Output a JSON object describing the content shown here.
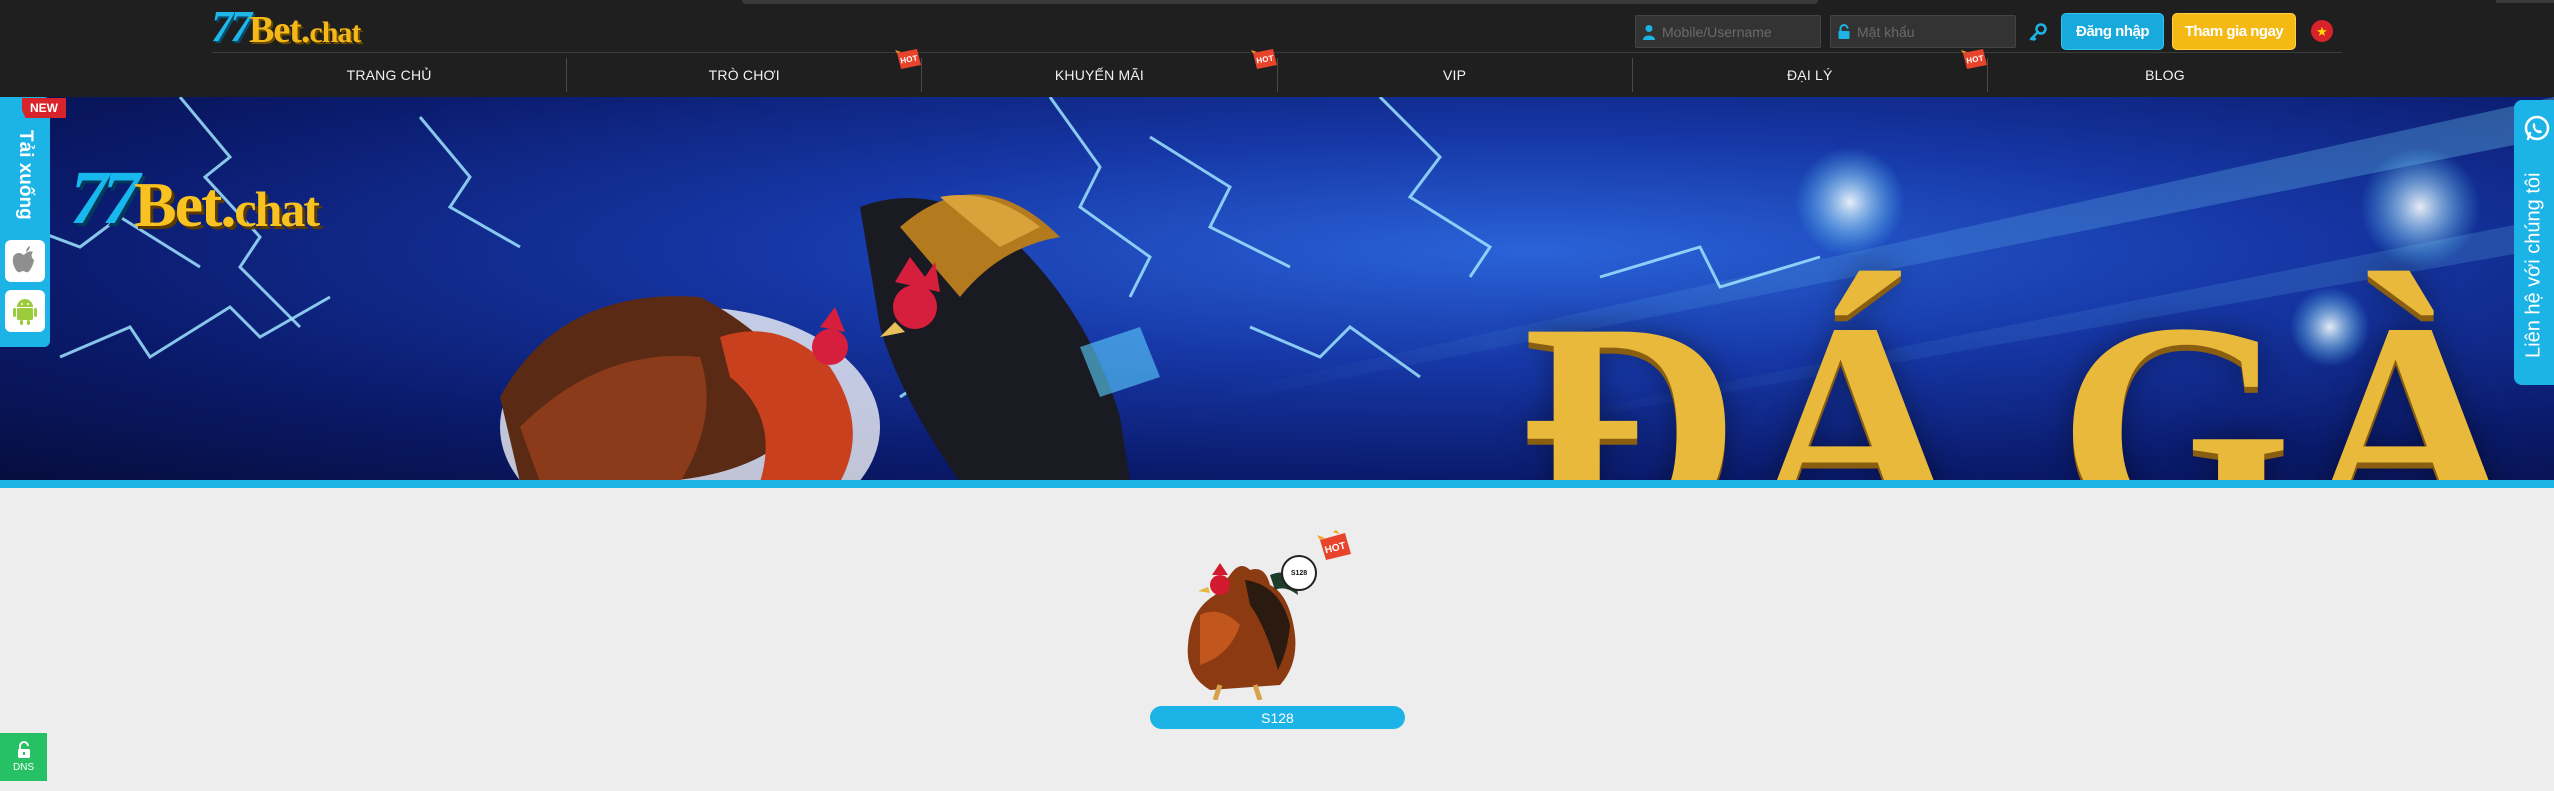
{
  "header": {
    "logo": {
      "number": "77",
      "brand": "Bet.",
      "suffix": "chat"
    },
    "username_placeholder": "Mobile/Username",
    "password_placeholder": "Mật khẩu",
    "login_label": "Đăng nhập",
    "join_label": "Tham gia ngay",
    "language_flag": "vn-flag-icon",
    "colors": {
      "accent": "#1cb3e6",
      "gold": "#f5b914",
      "background": "#1f1f1f"
    }
  },
  "nav": {
    "items": [
      {
        "label": "TRANG CHỦ",
        "hot": false
      },
      {
        "label": "TRÒ CHƠI",
        "hot": true
      },
      {
        "label": "KHUYẾN MÃI",
        "hot": true
      },
      {
        "label": "VIP",
        "hot": false
      },
      {
        "label": "ĐẠI LÝ",
        "hot": true
      },
      {
        "label": "BLOG",
        "hot": false
      }
    ],
    "hot_badge_text": "HOT"
  },
  "banner": {
    "logo": {
      "number": "77",
      "brand": "Bet.",
      "suffix": "chat"
    },
    "title": "ĐÁ GÀ"
  },
  "side": {
    "new_badge": "NEW",
    "download_label": "Tải xuống",
    "contact_label": "Liên hệ với chúng tôi"
  },
  "games": [
    {
      "label": "S128",
      "logo_text": "S128",
      "hot": true
    }
  ],
  "dns_label": "DNS"
}
